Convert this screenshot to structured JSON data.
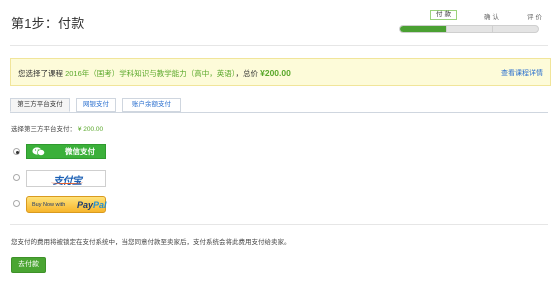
{
  "page": {
    "title": "第1步：付款"
  },
  "steps": {
    "items": [
      {
        "label": "付款"
      },
      {
        "label": "确认"
      },
      {
        "label": "评价"
      }
    ],
    "progress_fraction": 0.33
  },
  "notice": {
    "prefix": "您选择了课程",
    "course": "2016年（国考）学科知识与教学能力（高中，英语）",
    "total_label": "，总价",
    "price": "¥200.00",
    "details_link": "查看课程详情"
  },
  "tabs": [
    {
      "label": "第三方平台支付",
      "active": true
    },
    {
      "label": "网银支付",
      "active": false
    },
    {
      "label": "账户余额支付",
      "active": false
    }
  ],
  "payment": {
    "choose_label": "选择第三方平台支付：",
    "amount": "¥ 200.00",
    "options": [
      {
        "label": "微信支付",
        "selected": true
      },
      {
        "label": "支付宝",
        "selected": false
      },
      {
        "label_prefix": "Buy Now with",
        "logo_pay": "Pay",
        "logo_pal": "Pal",
        "selected": false
      }
    ]
  },
  "footer": {
    "note": "您支付的费用将被锁定在支付系统中，当您同意付款至卖家后，支付系统会将此费用支付给卖家。",
    "pay_button": "去付款"
  },
  "colors": {
    "accent_green": "#4aa032",
    "link_blue": "#2a6fcf",
    "notice_bg": "#fdfbd9"
  }
}
